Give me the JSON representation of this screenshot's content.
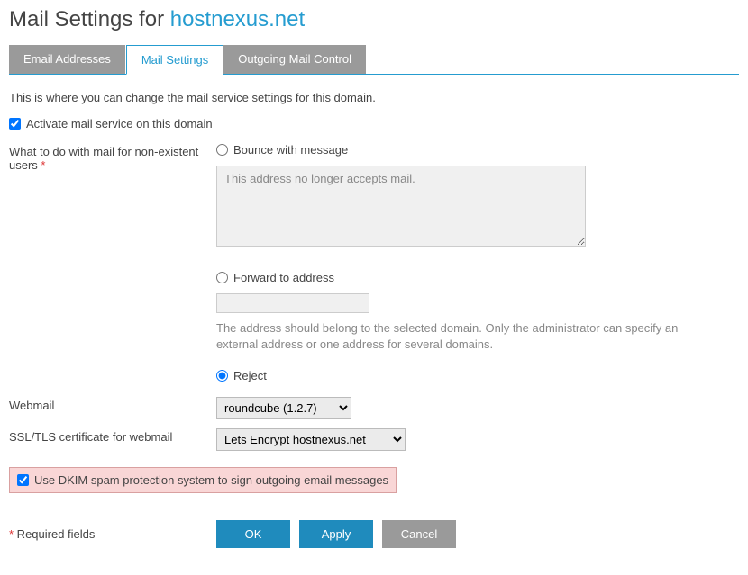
{
  "title_prefix": "Mail Settings for ",
  "domain": "hostnexus.net",
  "tabs": {
    "email_addresses": "Email Addresses",
    "mail_settings": "Mail Settings",
    "outgoing_mail_control": "Outgoing Mail Control"
  },
  "description": "This is where you can change the mail service settings for this domain.",
  "activate_label": "Activate mail service on this domain",
  "nonexistent": {
    "label": "What to do with mail for non-existent users ",
    "bounce_label": "Bounce with message",
    "bounce_text": "This address no longer accepts mail.",
    "forward_label": "Forward to address",
    "forward_value": "",
    "forward_hint": "The address should belong to the selected domain. Only the administrator can specify an external address or one address for several domains.",
    "reject_label": "Reject"
  },
  "webmail": {
    "label": "Webmail",
    "value": "roundcube (1.2.7)"
  },
  "ssl": {
    "label": "SSL/TLS certificate for webmail",
    "value": "Lets Encrypt hostnexus.net"
  },
  "dkim_label": "Use DKIM spam protection system to sign outgoing email messages",
  "required_note": " Required fields",
  "asterisk": "*",
  "buttons": {
    "ok": "OK",
    "apply": "Apply",
    "cancel": "Cancel"
  }
}
